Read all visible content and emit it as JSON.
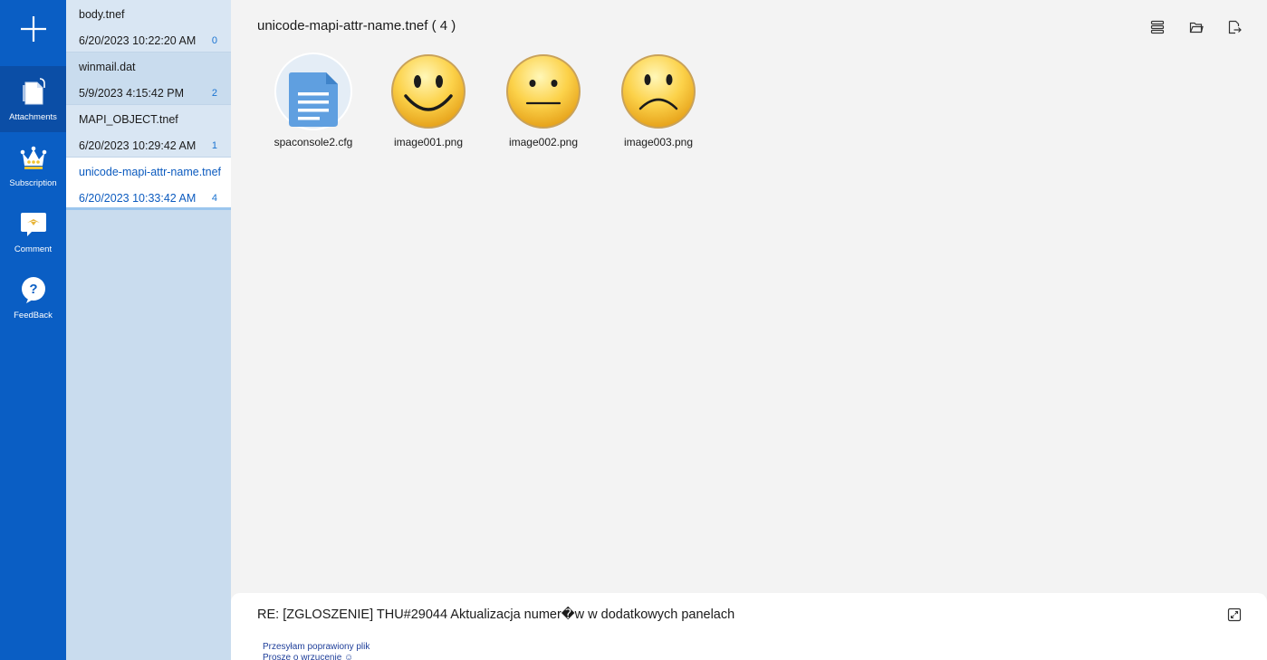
{
  "rail": {
    "items": [
      {
        "label": "Attachments",
        "icon": "attachments-icon"
      },
      {
        "label": "Subscription",
        "icon": "crown-icon"
      },
      {
        "label": "Comment",
        "icon": "comment-icon"
      },
      {
        "label": "FeedBack",
        "icon": "help-icon"
      }
    ]
  },
  "files": [
    {
      "name": "body.tnef",
      "date": "6/20/2023 10:22:20 AM",
      "count": "0"
    },
    {
      "name": "winmail.dat",
      "date": "5/9/2023 4:15:42 PM",
      "count": "2"
    },
    {
      "name": "MAPI_OBJECT.tnef",
      "date": "6/20/2023 10:29:42 AM",
      "count": "1"
    },
    {
      "name": "unicode-mapi-attr-name.tnef",
      "date": "6/20/2023 10:33:42 AM",
      "count": "4"
    }
  ],
  "main": {
    "title": "unicode-mapi-attr-name.tnef ( 4 )",
    "attachments": [
      {
        "name": "spaconsole2.cfg",
        "icon": "document-icon"
      },
      {
        "name": "image001.png",
        "icon": "smiley-happy-icon"
      },
      {
        "name": "image002.png",
        "icon": "smiley-neutral-icon"
      },
      {
        "name": "image003.png",
        "icon": "smiley-sad-icon"
      }
    ]
  },
  "message": {
    "subject": "RE: [ZGLOSZENIE] THU#29044 Aktualizacja numer�w w dodatkowych panelach",
    "body_line1": "Przesyłam poprawiony plik",
    "body_line2": "Proszę o wrzucenie ☺"
  },
  "colors": {
    "rail": "#0a5ec4",
    "rail_active": "#0b4ea6",
    "file_list": "#c9dcee",
    "accent": "#0c5bbf"
  }
}
